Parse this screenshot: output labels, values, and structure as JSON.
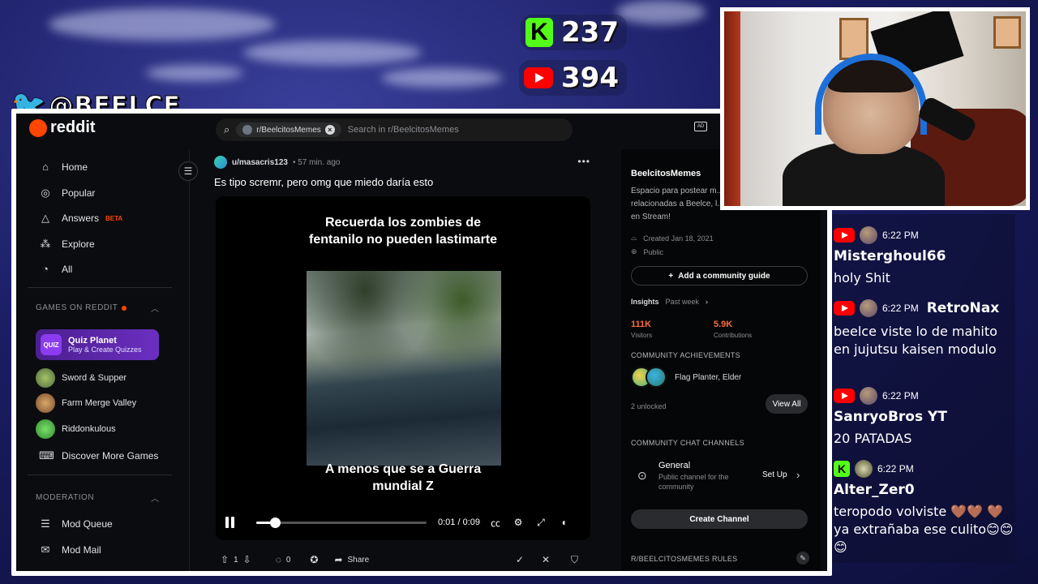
{
  "counters": {
    "kick": "237",
    "youtube": "394"
  },
  "twitter": {
    "handle": "@BEELCE_"
  },
  "reddit": {
    "brand": "reddit",
    "search": {
      "chip": "r/BeelcitosMemes",
      "placeholder": "Search in r/BeelcitosMemes"
    },
    "nav": [
      {
        "icon": "home-icon",
        "label": "Home"
      },
      {
        "icon": "popular-icon",
        "label": "Popular"
      },
      {
        "icon": "answers-icon",
        "label": "Answers",
        "badge": "BETA"
      },
      {
        "icon": "explore-icon",
        "label": "Explore"
      },
      {
        "icon": "all-icon",
        "label": "All"
      }
    ],
    "games": {
      "title": "GAMES ON REDDIT",
      "featured": {
        "logo": "QUIZ",
        "title": "Quiz Planet",
        "subtitle": "Play & Create Quizzes"
      },
      "items": [
        "Sword & Supper",
        "Farm Merge Valley",
        "Riddonkulous",
        "Discover More Games"
      ]
    },
    "moderation": {
      "title": "MODERATION",
      "items": [
        "Mod Queue",
        "Mod Mail"
      ]
    },
    "post": {
      "author": "u/masacris123",
      "time": "• 57 min. ago",
      "title": "Es tipo scremr, pero omg que miedo daría esto",
      "caption_top": "Recuerda los zombies de fentanilo no pueden lastimarte",
      "caption_bottom": "A menos que se a Guerra mundial Z",
      "video": {
        "time": "0:01 / 0:09",
        "progress": 0.11
      },
      "votes": "1",
      "comments": "0",
      "share": "Share"
    },
    "community": {
      "name": "BeelcitosMemes",
      "description": "Espacio para postear m... relacionadas a Beelce, l... salir en Stream!",
      "created": "Created Jan 18, 2021",
      "visibility": "Public",
      "guide_button": "Add a community guide",
      "insights": "Insights",
      "insights_range": "Past week",
      "visitors": "111K",
      "visitors_label": "Visitors",
      "contributions": "5.9K",
      "contributions_label": "Contributions",
      "achievements_title": "COMMUNITY ACHIEVEMENTS",
      "achievements_text": "Flag Planter, Elder",
      "unlocked": "2 unlocked",
      "view_all": "View All",
      "chat_title": "COMMUNITY CHAT CHANNELS",
      "channel_name": "General",
      "channel_desc": "Public channel for the community",
      "setup": "Set Up",
      "create_channel": "Create Channel",
      "rules_title": "R/BEELCITOSMEMES RULES"
    }
  },
  "chat": [
    {
      "platform": "youtube",
      "time": "6:22 PM",
      "user": "Misterghoul66",
      "text": "holy Shit"
    },
    {
      "platform": "youtube",
      "time": "6:22 PM",
      "user": "RetroNax",
      "text": "beelce viste lo de mahito en jujutsu kaisen modulo"
    },
    {
      "platform": "youtube",
      "time": "6:22 PM",
      "user": "SanryoBros YT",
      "text": "20 PATADAS"
    },
    {
      "platform": "kick",
      "time": "6:22 PM",
      "user": "Alter_Zer0",
      "text": "teropodo volviste 🤎🤎 🤎 ya extrañaba ese culito😊😊😊"
    }
  ],
  "colors": {
    "reddit_orange": "#ff4500",
    "kick_green": "#53fc18",
    "youtube_red": "#ff0000"
  }
}
